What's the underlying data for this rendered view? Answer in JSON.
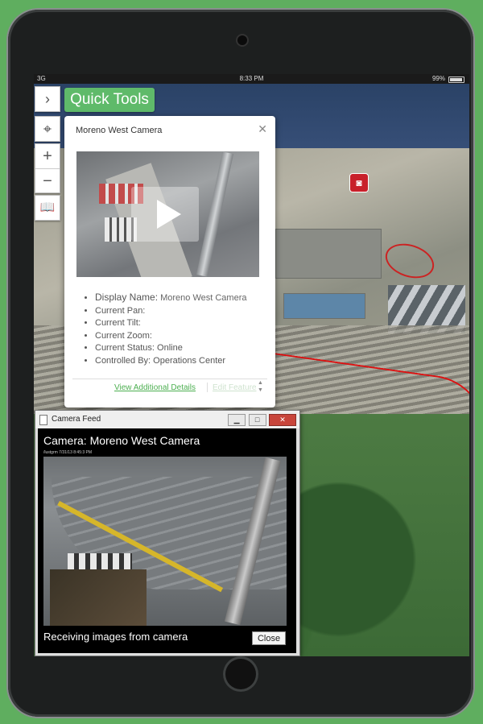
{
  "status_bar": {
    "carrier": "3G",
    "time": "8:33 PM",
    "battery": "99%"
  },
  "map_controls": {
    "expand_glyph": "›",
    "locate_glyph": "⌖",
    "zoom_in_glyph": "+",
    "zoom_out_glyph": "−",
    "book_glyph": "📖"
  },
  "quick_tools": {
    "label": "Quick Tools"
  },
  "popup": {
    "title": "Moreno West Camera",
    "close_glyph": "✕",
    "details": [
      {
        "label": "Display Name:",
        "value": "Moreno West Camera"
      },
      {
        "label": "Current Pan:",
        "value": ""
      },
      {
        "label": "Current Tilt:",
        "value": ""
      },
      {
        "label": "Current Zoom:",
        "value": ""
      },
      {
        "label": "Current Status:",
        "value": "Online"
      },
      {
        "label": "Controlled By:",
        "value": "Operations Center"
      }
    ],
    "link_details": "View Additional Details",
    "link_edit": "Edit Feature"
  },
  "camera_feed": {
    "window_title": "Camera Feed",
    "win_minimize": "▁",
    "win_maximize": "□",
    "win_close": "✕",
    "camera_title": "Camera: Moreno West Camera",
    "timestamp": "/lustgrm 7/31/13 8:45:3 PM",
    "status": "Receiving images from camera",
    "close_label": "Close"
  },
  "colors": {
    "accent": "#5fba6a",
    "link": "#4caf50",
    "marker": "#c8202a"
  }
}
